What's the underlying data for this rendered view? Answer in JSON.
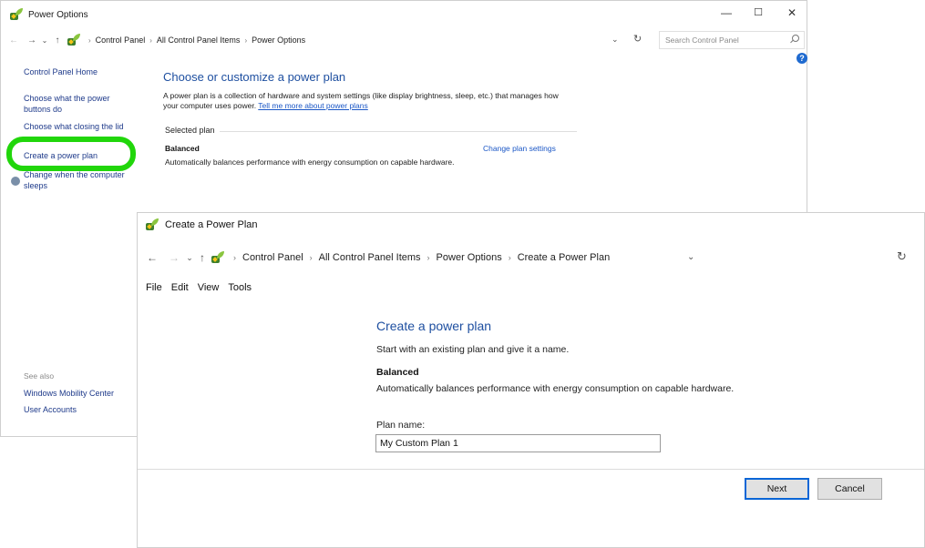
{
  "back_window": {
    "title": "Power Options",
    "controls": {
      "minimize": "—",
      "maximize": "☐",
      "close": "✕"
    },
    "breadcrumb": [
      "Control Panel",
      "All Control Panel Items",
      "Power Options"
    ],
    "search_placeholder": "Search Control Panel",
    "help": "?",
    "sidebar": {
      "home": "Control Panel Home",
      "power_buttons": "Choose what the power buttons do",
      "closing_lid": "Choose what closing the lid",
      "create_plan": "Create a power plan",
      "sleep": "Change when the computer sleeps",
      "see_also": "See also",
      "mobility_center": "Windows Mobility Center",
      "user_accounts": "User Accounts"
    },
    "main": {
      "heading": "Choose or customize a power plan",
      "description": "A power plan is a collection of hardware and system settings (like display brightness, sleep, etc.) that manages how your computer uses power.",
      "learn_link": "Tell me more about power plans",
      "selected_plan_label": "Selected plan",
      "plan_name": "Balanced",
      "change_link": "Change plan settings",
      "plan_description": "Automatically balances performance with energy consumption on capable hardware."
    }
  },
  "front_window": {
    "title": "Create a Power Plan",
    "breadcrumb": [
      "Control Panel",
      "All Control Panel Items",
      "Power Options",
      "Create a Power Plan"
    ],
    "menu": [
      "File",
      "Edit",
      "View",
      "Tools"
    ],
    "heading": "Create a power plan",
    "subtitle": "Start with an existing plan and give it a name.",
    "plan_name": "Balanced",
    "plan_description": "Automatically balances performance with energy consumption on capable hardware.",
    "plan_name_label": "Plan name:",
    "plan_name_value": "My Custom Plan 1",
    "next_button": "Next",
    "cancel_button": "Cancel"
  },
  "colors": {
    "highlight_ring": "#21d60b",
    "link": "#1b57c6",
    "heading": "#1e4fa0"
  }
}
